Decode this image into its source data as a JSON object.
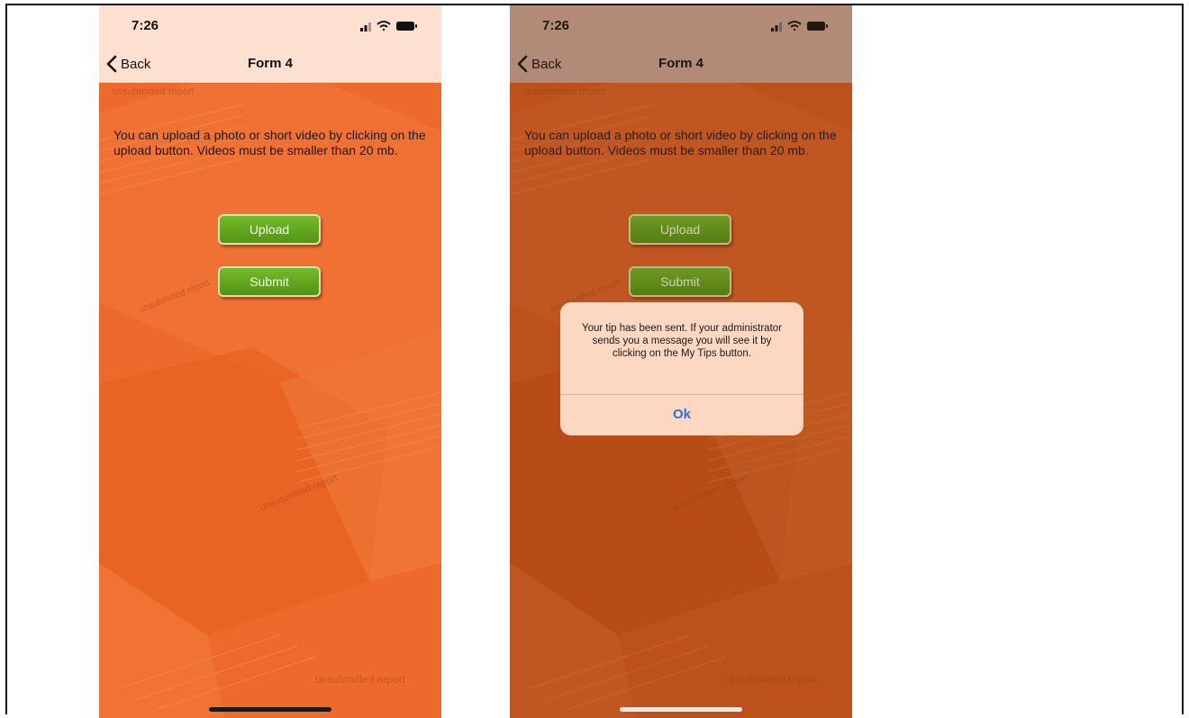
{
  "screens": [
    {
      "status": {
        "time": "7:26"
      },
      "nav": {
        "back_label": "Back",
        "title": "Form 4"
      },
      "watermark_text": "unsubmitted report",
      "instructions": "You can upload a photo or short video by clicking on the upload button. Videos must be smaller than 20 mb.",
      "buttons": {
        "upload": "Upload",
        "submit": "Submit"
      }
    },
    {
      "status": {
        "time": "7:26"
      },
      "nav": {
        "back_label": "Back",
        "title": "Form 4"
      },
      "watermark_text": "unsubmitted report",
      "instructions": "You can upload a photo or short video by clicking on the upload button. Videos must be smaller than 20 mb.",
      "buttons": {
        "upload": "Upload",
        "submit": "Submit"
      },
      "alert": {
        "message": "Your tip has been sent. If your administrator sends you a message you will see it by clicking on the My Tips button.",
        "ok_label": "Ok"
      }
    }
  ],
  "colors": {
    "background_orange": "#ee6a2c",
    "button_green": "#5fa31e",
    "alert_link_blue": "#2f6fdd"
  },
  "icons": [
    "back-chevron-icon",
    "signal-icon",
    "wifi-icon",
    "battery-icon"
  ]
}
